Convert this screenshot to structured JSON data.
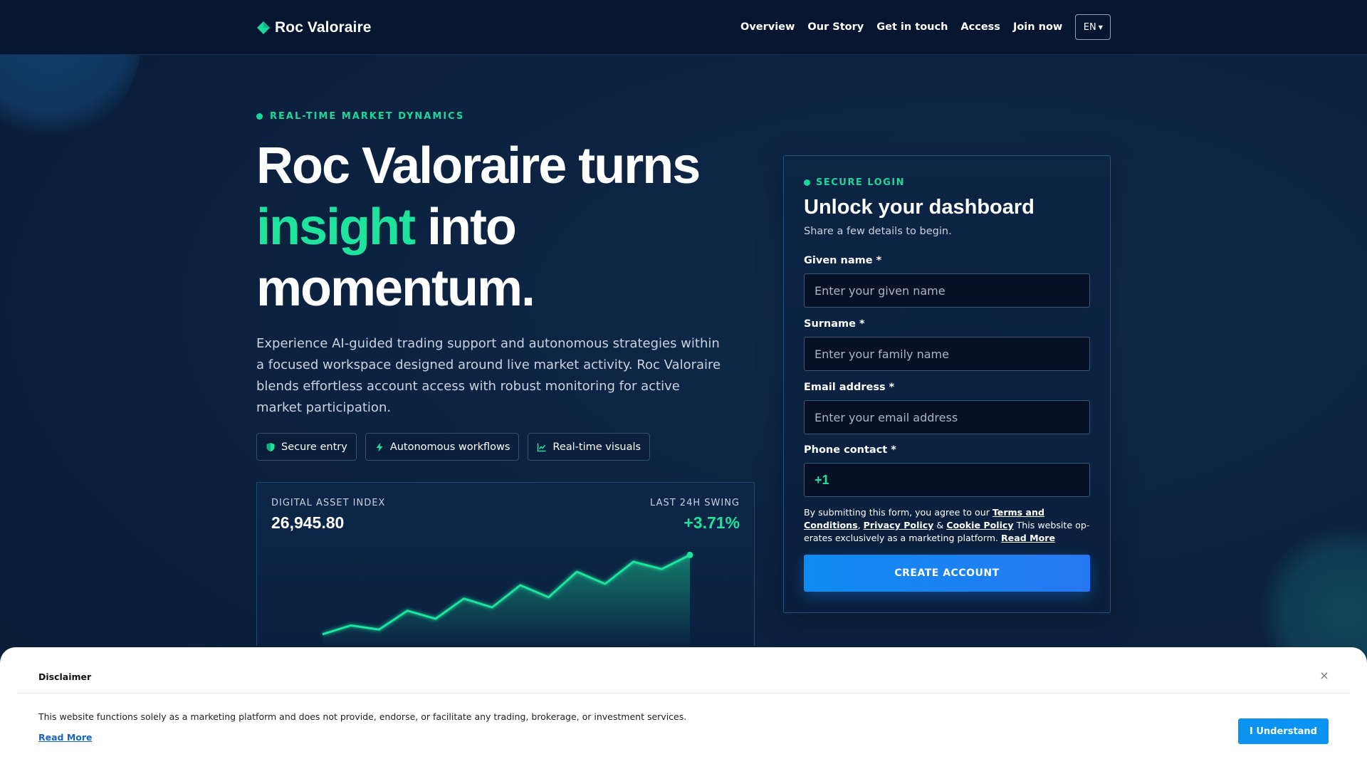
{
  "brand": {
    "name": "Roc Valoraire",
    "accent": "#1de39d"
  },
  "nav": {
    "links": [
      "Overview",
      "Our Story",
      "Get in touch",
      "Access",
      "Join now"
    ],
    "language": "EN"
  },
  "hero": {
    "eyebrow": "REAL-TIME MARKET DYNAMICS",
    "title_line1": "Roc Valoraire turns",
    "title_accent": "insight",
    "title_line2_rest": " into",
    "title_line3": "momentum.",
    "description": "Experience AI-guided trading support and autonomous strategies within a focused workspace designed around live market activity. Roc Valoraire blends effortless account access with robust monitoring for active market participation.",
    "chips": [
      {
        "label": "Secure entry",
        "icon": "shield-icon"
      },
      {
        "label": "Autonomous workflows",
        "icon": "bolt-icon"
      },
      {
        "label": "Real-time visuals",
        "icon": "line-chart-icon"
      }
    ]
  },
  "index_card": {
    "label": "DIGITAL ASSET INDEX",
    "value": "26,945.80",
    "swing_label": "LAST 24H SWING",
    "swing_value": "+3.71%"
  },
  "chart_data": {
    "type": "area",
    "title": "",
    "xlabel": "",
    "ylabel": "",
    "x": [
      1,
      2,
      3,
      4,
      5,
      6,
      7,
      8,
      9,
      10,
      11,
      12,
      13,
      14
    ],
    "series": [
      {
        "values": [
          1.2,
          2.5,
          1.9,
          4.7,
          3.5,
          6.5,
          5.2,
          8.5,
          6.7,
          10.5,
          8.7,
          12.0,
          10.9,
          13.0
        ]
      }
    ],
    "ylim": [
      0,
      14
    ],
    "grid": false,
    "color": "#1de39d"
  },
  "login": {
    "eyebrow": "SECURE LOGIN",
    "title": "Unlock your dashboard",
    "subtitle": "Share a few details to begin.",
    "fields": {
      "given_name": {
        "label": "Given name *",
        "placeholder": "Enter your given name"
      },
      "surname": {
        "label": "Surname *",
        "placeholder": "Enter your family name"
      },
      "email": {
        "label": "Email address *",
        "placeholder": "Enter your email address"
      },
      "phone": {
        "label": "Phone contact *",
        "prefix": "+1",
        "value": ""
      }
    },
    "consent": {
      "prefix": "By submitting this form, you agree to our ",
      "terms": "Terms and Conditions",
      "sep1": ", ",
      "privacy": "Privacy Policy",
      "sep2": " & ",
      "cookie": "Cookie Policy",
      "middle": " This website op­erates exclusively as a marketing platform. ",
      "read_more": "Read More"
    },
    "cta": "CREATE ACCOUNT"
  },
  "disclaimer": {
    "title": "Disclaimer",
    "text": "This website functions solely as a marketing platform and does not provide, endorse, or facilitate any trading, brokerage, or investment services.",
    "read_more": "Read More",
    "button": "I Understand",
    "close": "×"
  }
}
